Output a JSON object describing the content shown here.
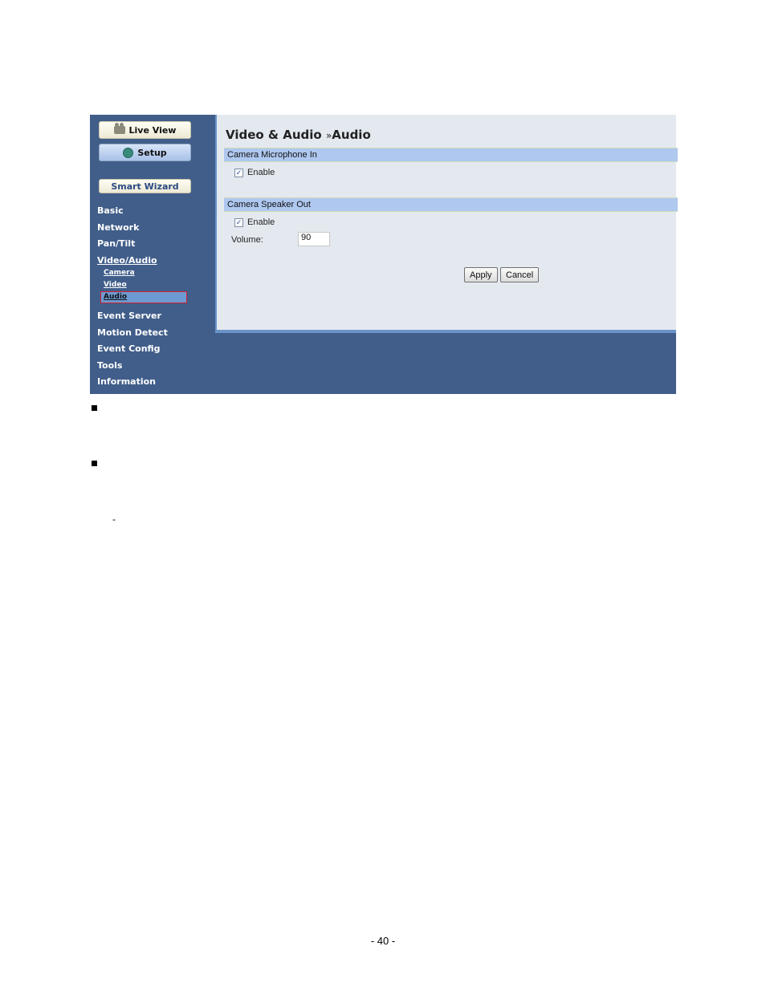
{
  "sidebar": {
    "live_view": "Live View",
    "setup": "Setup",
    "smart_wizard": "Smart Wizard",
    "items": [
      "Basic",
      "Network",
      "Pan/Tilt",
      "Video/Audio"
    ],
    "sub_items": [
      "Camera",
      "Video",
      "Audio"
    ],
    "items_lower": [
      "Event Server",
      "Motion Detect",
      "Event Config",
      "Tools",
      "Information"
    ]
  },
  "content": {
    "title_main": "Video & Audio",
    "title_sep": "»",
    "title_sub": "Audio",
    "mic_section": "Camera Microphone In",
    "mic_enable": "Enable",
    "mic_checked": "✓",
    "speaker_section": "Camera Speaker Out",
    "speaker_enable": "Enable",
    "speaker_checked": "✓",
    "volume_label": "Volume:",
    "volume_value": "90",
    "apply": "Apply",
    "cancel": "Cancel"
  },
  "document": {
    "dash": "-",
    "page_number": "- 40 -"
  }
}
